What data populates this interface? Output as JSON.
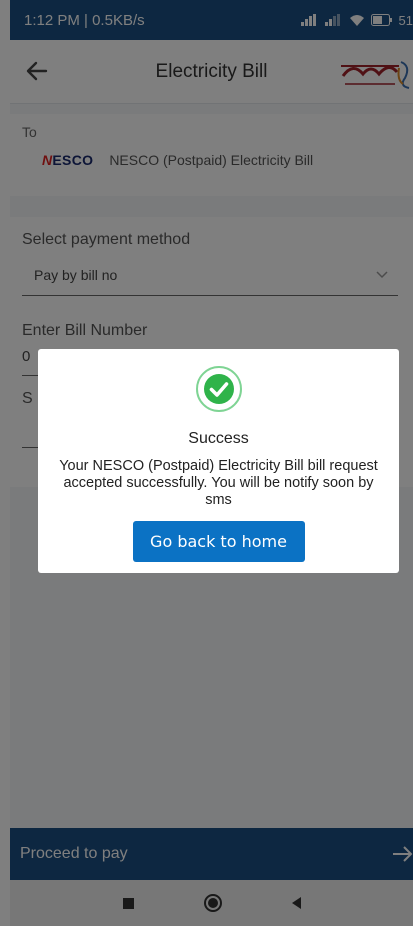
{
  "status_bar": {
    "time_speed": "1:12 PM | 0.5KB/s",
    "battery": "51"
  },
  "app_bar": {
    "title": "Electricity Bill"
  },
  "to_card": {
    "label": "To",
    "biller_logo_first": "N",
    "biller_logo_rest": "ESCO",
    "biller_name": "NESCO (Postpaid) Electricity Bill"
  },
  "form": {
    "payment_method_label": "Select payment method",
    "payment_method_value": "Pay by bill no",
    "bill_number_label": "Enter Bill Number",
    "bill_number_value": "0",
    "third_label": "S"
  },
  "dialog": {
    "title": "Success",
    "message": "Your NESCO (Postpaid) Electricity Bill bill request accepted successfully. You will be notify soon by sms",
    "button_label": "Go back to home"
  },
  "proceed": {
    "label": "Proceed to pay"
  },
  "colors": {
    "primary": "#1a4f82",
    "button": "#0b72c4",
    "success_green": "#2fb34a"
  },
  "icons": [
    "back-arrow-icon",
    "chevron-down-icon",
    "check-circle-icon",
    "arrow-right-icon",
    "signal-icon",
    "wifi-icon",
    "battery-icon"
  ]
}
